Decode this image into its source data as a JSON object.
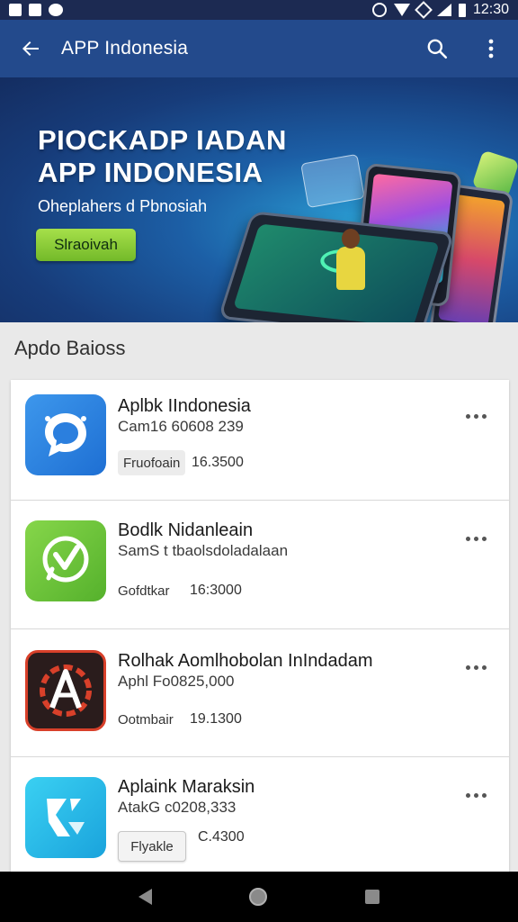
{
  "status_bar": {
    "time": "12:30"
  },
  "app_bar": {
    "title": "APP Indonesia"
  },
  "banner": {
    "title_line1": "PIOCKADP IADAN",
    "title_line2": "APP INDONESIA",
    "subtitle": "Oheplahers d Pbnosiah",
    "button_label": "Slraoivah"
  },
  "section": {
    "title": "Apdo Baioss"
  },
  "apps": [
    {
      "name": "Aplbk IIndonesia",
      "meta": "Cam16 60608 239",
      "chip": "Fruofoain",
      "value": "16.3500",
      "icon": "chat-bubble-icon",
      "color": "#2f86e0"
    },
    {
      "name": "Bodlk Nidanleain",
      "meta": "SamS t tbaolsdoladalaan",
      "chip": "Gofdtkar",
      "value": "16:3000",
      "icon": "checkmark-bubble-icon",
      "color": "#6cc63b"
    },
    {
      "name": "Rolhak Aomlhobolan InIndadam",
      "meta": "Aphl Fo0825,000",
      "chip": "Ootmbair",
      "value": "19.1300",
      "icon": "letter-a-gear-icon",
      "color": "#c8301e"
    },
    {
      "name": "Aplaink Maraksin",
      "meta": "AtakG c0208,333",
      "chip": "Flyakle",
      "value": "C.4300",
      "icon": "k-arrow-icon",
      "color": "#23b9e8"
    }
  ]
}
